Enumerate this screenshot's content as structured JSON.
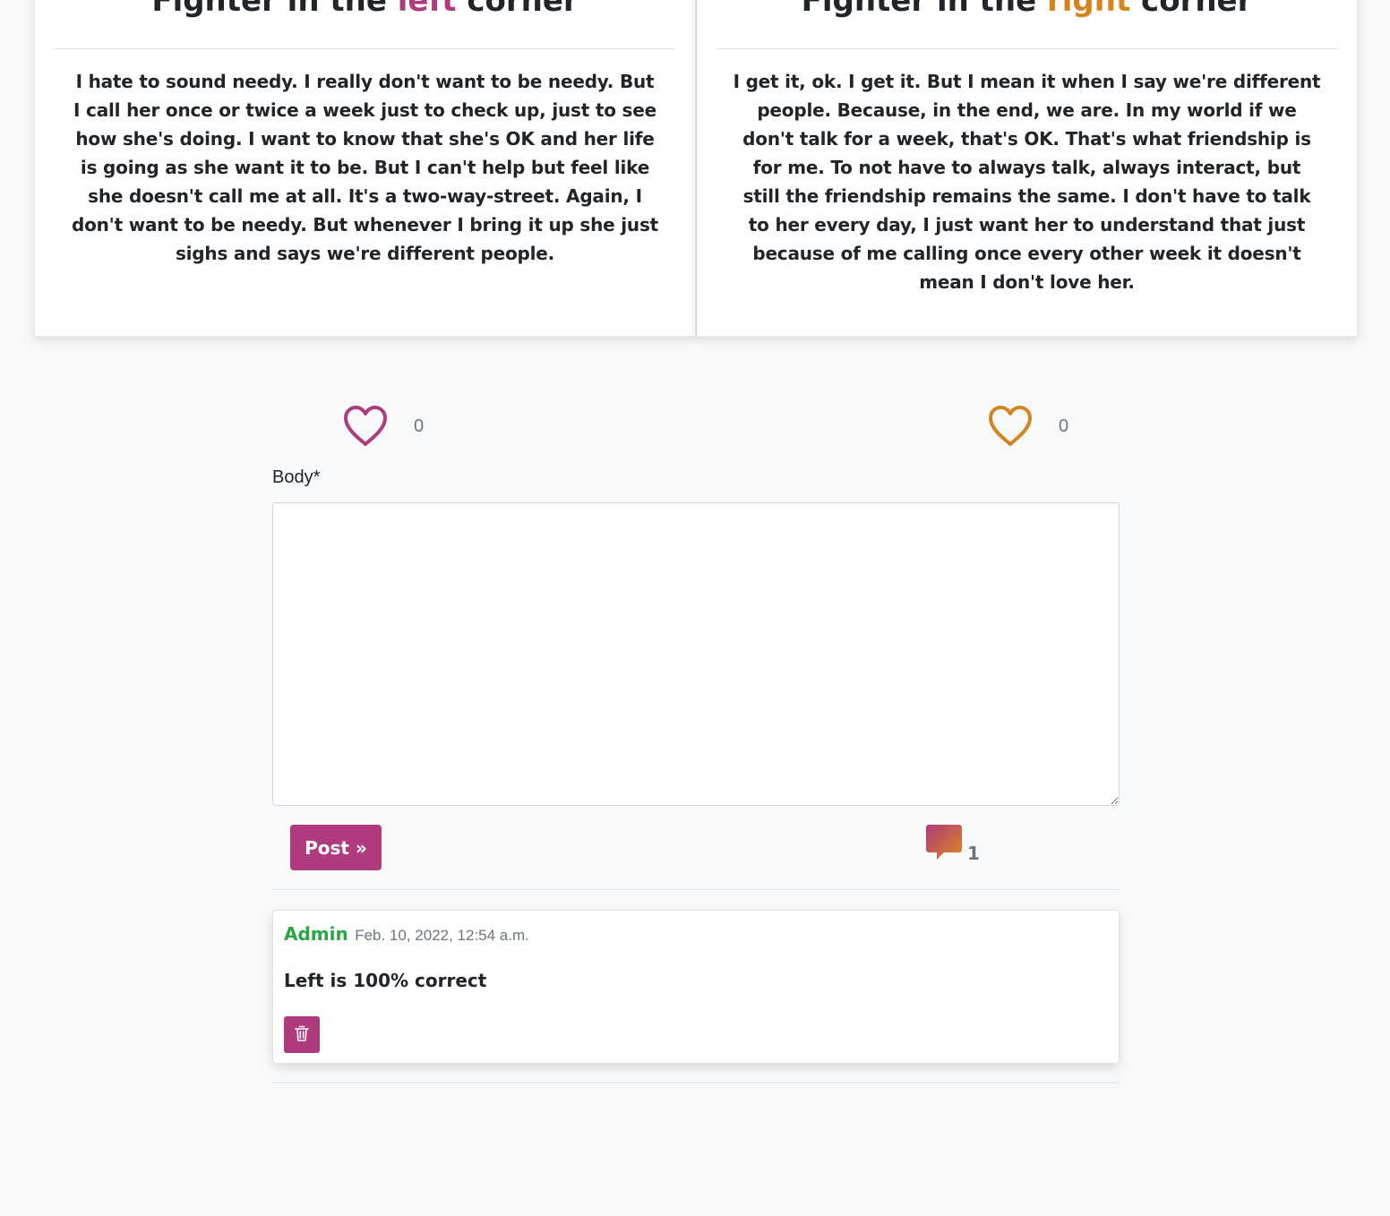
{
  "left_card": {
    "title_prefix": "Fighter in the ",
    "title_accent": "left",
    "title_suffix": " corner",
    "body": "I hate to sound needy. I really don't want to be needy. But I call her once or twice a week just to check up, just to see how she's doing. I want to know that she's OK and her life is going as she want it to be. But I can't help but feel like she doesn't call me at all. It's a two-way-street. Again, I don't want to be needy. But whenever I bring it up she just sighs and says we're different people."
  },
  "right_card": {
    "title_prefix": "Fighter in the ",
    "title_accent": "right",
    "title_suffix": " corner",
    "body": "I get it, ok. I get it. But I mean it when I say we're different people. Because, in the end, we are. In my world if we don't talk for a week, that's OK. That's what friendship is for me. To not have to always talk, always interact, but still the friendship remains the same. I don't have to talk to her every day, I just want her to understand that just because of me calling once every other week it doesn't mean I don't love her."
  },
  "votes": {
    "left_count": "0",
    "right_count": "0",
    "icon": "heart-outline"
  },
  "form": {
    "body_label": "Body*",
    "body_value": "",
    "post_label": "Post »"
  },
  "comments_summary": {
    "icon": "speech-bubble",
    "count": "1"
  },
  "comments": [
    {
      "author": "Admin",
      "date": "Feb. 10, 2022, 12:54 a.m.",
      "body": "Left is 100% correct",
      "delete_icon": "trash"
    }
  ],
  "colors": {
    "left_accent": "#b03a7e",
    "right_accent": "#d5831c",
    "author_green": "#28a745",
    "background": "#f8f9fa"
  }
}
